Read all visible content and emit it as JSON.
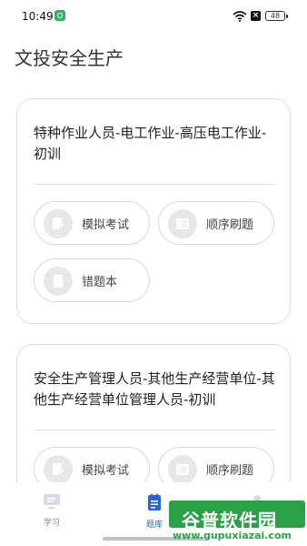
{
  "status_bar": {
    "time": "10:49",
    "battery": "48",
    "icons": [
      "app-notification-icon",
      "wifi-icon",
      "sim-x-icon",
      "battery-icon"
    ]
  },
  "page_title": "文投安全生产",
  "cards": [
    {
      "title": "特种作业人员-电工作业-高压电工作业-初训",
      "buttons": {
        "mock_exam": "模拟考试",
        "sequential": "顺序刷题",
        "wrong_book": "错题本"
      }
    },
    {
      "title": "安全生产管理人员-其他生产经营单位-其他生产经营单位管理人员-初训",
      "buttons": {
        "mock_exam": "模拟考试",
        "sequential": "顺序刷题"
      }
    }
  ],
  "tab_bar": {
    "learn": "学习",
    "question_bank": "题库",
    "active": "题库"
  },
  "watermark": {
    "name": "谷普软件园",
    "url": "www.gupuxiazai.com"
  },
  "colors": {
    "accent": "#2b63d9",
    "watermark_green": "#2aa146"
  }
}
